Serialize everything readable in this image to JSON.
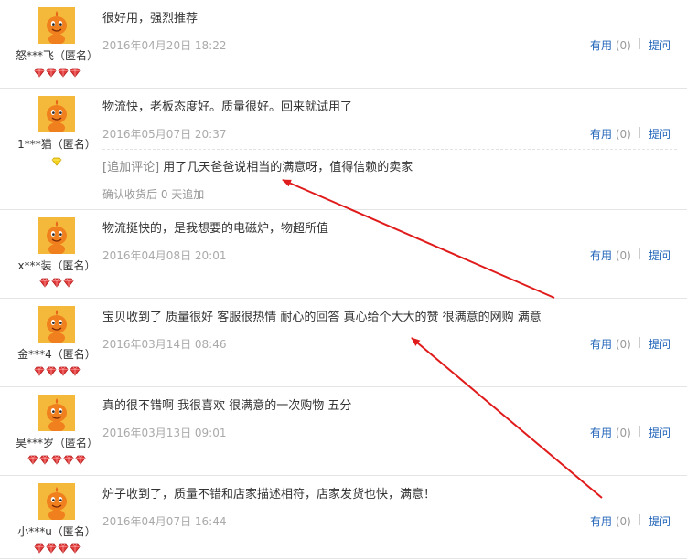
{
  "reviews": [
    {
      "username": "怒***飞（匿名）",
      "content": "很好用，强烈推荐",
      "date": "2016年04月20日 18:22",
      "useful_label": "有用",
      "useful_count": "(0)",
      "ask_label": "提问",
      "badge": "red-gem",
      "badge_count": 4
    },
    {
      "username": "1***猫（匿名）",
      "content": "物流快，老板态度好。质量很好。回来就试用了",
      "date": "2016年05月07日 20:37",
      "useful_label": "有用",
      "useful_count": "(0)",
      "ask_label": "提问",
      "badge": "yellow-diamond",
      "badge_count": 1,
      "followup_tag": "[追加评论]",
      "followup_text": " 用了几天爸爸说相当的满意呀，值得信赖的卖家",
      "confirmed_text": "确认收货后 0 天追加"
    },
    {
      "username": "x***装（匿名）",
      "content": "物流挺快的，是我想要的电磁炉，物超所值",
      "date": "2016年04月08日 20:01",
      "useful_label": "有用",
      "useful_count": "(0)",
      "ask_label": "提问",
      "badge": "red-gem",
      "badge_count": 3
    },
    {
      "username": "金***4（匿名）",
      "content": "宝贝收到了 质量很好 客服很热情 耐心的回答 真心给个大大的赞 很满意的网购 满意",
      "date": "2016年03月14日 08:46",
      "useful_label": "有用",
      "useful_count": "(0)",
      "ask_label": "提问",
      "badge": "red-gem",
      "badge_count": 4
    },
    {
      "username": "昊***岁（匿名）",
      "content": "真的很不错啊 我很喜欢 很满意的一次购物 五分",
      "date": "2016年03月13日 09:01",
      "useful_label": "有用",
      "useful_count": "(0)",
      "ask_label": "提问",
      "badge": "red-gem",
      "badge_count": 5
    },
    {
      "username": "小***u（匿名）",
      "content": "炉子收到了，质量不错和店家描述相符，店家发货也快，满意！",
      "date": "2016年04月07日 16:44",
      "useful_label": "有用",
      "useful_count": "(0)",
      "ask_label": "提问",
      "badge": "red-gem",
      "badge_count": 4
    }
  ],
  "colors": {
    "link": "#1f63b8",
    "annotation_arrow": "#e01b1b",
    "avatar_bg": "#f4b93b"
  }
}
